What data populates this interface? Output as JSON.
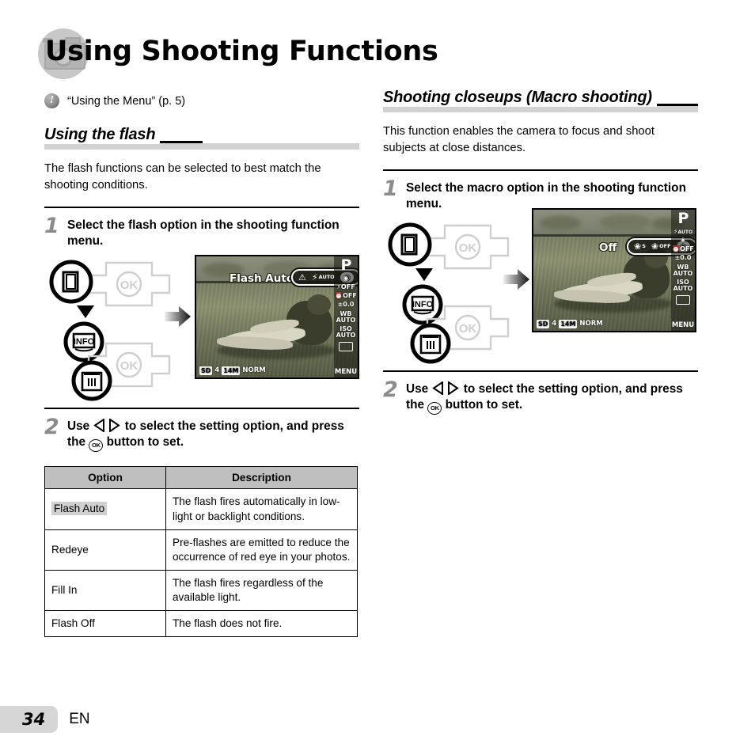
{
  "document": {
    "title": "Using Shooting Functions",
    "page_number": "34",
    "language": "EN"
  },
  "note": {
    "text": "“Using the Menu” (p. 5)",
    "icon": "exclamation-icon"
  },
  "left_column": {
    "section_heading": "Using the flash",
    "intro": "The flash functions can be selected to best match the shooting conditions.",
    "step1": {
      "number": "1",
      "text": "Select the flash option in the shooting function menu."
    },
    "step2": {
      "number": "2",
      "text_part1": "Use",
      "text_part2": "to select the setting option, and press the",
      "ok_label": "OK",
      "text_part3": "button to set."
    },
    "lcd": {
      "label": "Flash Auto",
      "mode": "P",
      "options": [
        {
          "name": "flash-off-icon",
          "glyph": "⚡",
          "sub": "",
          "selected": false
        },
        {
          "name": "flash-auto-icon",
          "glyph": "⚡",
          "sub": "AUTO",
          "selected": false
        },
        {
          "name": "redeye-icon",
          "glyph": "◉",
          "sub": "",
          "selected": true
        }
      ],
      "strip": [
        {
          "name": "mode-p",
          "text": "P"
        },
        {
          "name": "redeye-indicator",
          "text": "◉"
        },
        {
          "name": "flash-off-indicator",
          "text": "OFF"
        },
        {
          "name": "selftimer-off-indicator",
          "text": "OFF"
        },
        {
          "name": "exposure-comp",
          "text": "±0.0"
        },
        {
          "name": "white-balance",
          "text": "WB AUTO"
        },
        {
          "name": "iso",
          "text": "ISO AUTO"
        },
        {
          "name": "drive-mode",
          "text": ""
        },
        {
          "name": "menu",
          "text": "MENU"
        }
      ],
      "bottom": {
        "card": "SD",
        "shots": "4",
        "resolution": "14M",
        "quality": "NORM"
      }
    },
    "table": {
      "headers": [
        "Option",
        "Description"
      ],
      "rows": [
        {
          "option": "Flash Auto",
          "highlight": true,
          "description": "The flash fires automatically in low-light or backlight conditions."
        },
        {
          "option": "Redeye",
          "highlight": false,
          "description": "Pre-flashes are emitted to reduce the occurrence of red eye in your photos."
        },
        {
          "option": "Fill In",
          "highlight": false,
          "description": "The flash fires regardless of the available light."
        },
        {
          "option": "Flash Off",
          "highlight": false,
          "description": "The flash does not fire."
        }
      ]
    }
  },
  "right_column": {
    "section_heading": "Shooting closeups (Macro shooting)",
    "intro": "This function enables the camera to focus and shoot subjects at close distances.",
    "step1": {
      "number": "1",
      "text": "Select the macro option in the shooting function menu."
    },
    "step2": {
      "number": "2",
      "text_part1": "Use",
      "text_part2": "to select the setting option, and press the",
      "ok_label": "OK",
      "text_part3": "button to set."
    },
    "lcd": {
      "label": "Off",
      "mode": "P",
      "options": [
        {
          "name": "super-macro-icon",
          "glyph": "❀",
          "sub": "S",
          "selected": false
        },
        {
          "name": "macro-off-icon",
          "glyph": "❀",
          "sub": "OFF",
          "selected": false
        },
        {
          "name": "macro-icon",
          "glyph": "❀",
          "sub": "",
          "selected": true
        }
      ],
      "strip": [
        {
          "name": "mode-p",
          "text": "P"
        },
        {
          "name": "flash-auto-indicator",
          "text": "AUTO"
        },
        {
          "name": "macro-indicator",
          "text": "❀"
        },
        {
          "name": "selftimer-off-indicator",
          "text": "OFF"
        },
        {
          "name": "exposure-comp",
          "text": "±0.0"
        },
        {
          "name": "white-balance",
          "text": "WB AUTO"
        },
        {
          "name": "iso",
          "text": "ISO AUTO"
        },
        {
          "name": "drive-mode",
          "text": ""
        },
        {
          "name": "menu",
          "text": "MENU"
        }
      ],
      "bottom": {
        "card": "SD",
        "shots": "4",
        "resolution": "14M",
        "quality": "NORM"
      }
    }
  },
  "button_diagram": {
    "top_button": "left-arrow-button",
    "info_button": "INFO",
    "delete_button": "trash-button",
    "ok_button": "OK",
    "down_arrow": "down-arrow-icon",
    "flow_arrow": "right-arrow-icon"
  },
  "colors": {
    "heading_rule": "#d2d2d2",
    "table_header": "#bfbfbf",
    "highlight": "#d0d0d0",
    "step_number": "#8c8c8c",
    "page_box": "#d6d6d6"
  }
}
